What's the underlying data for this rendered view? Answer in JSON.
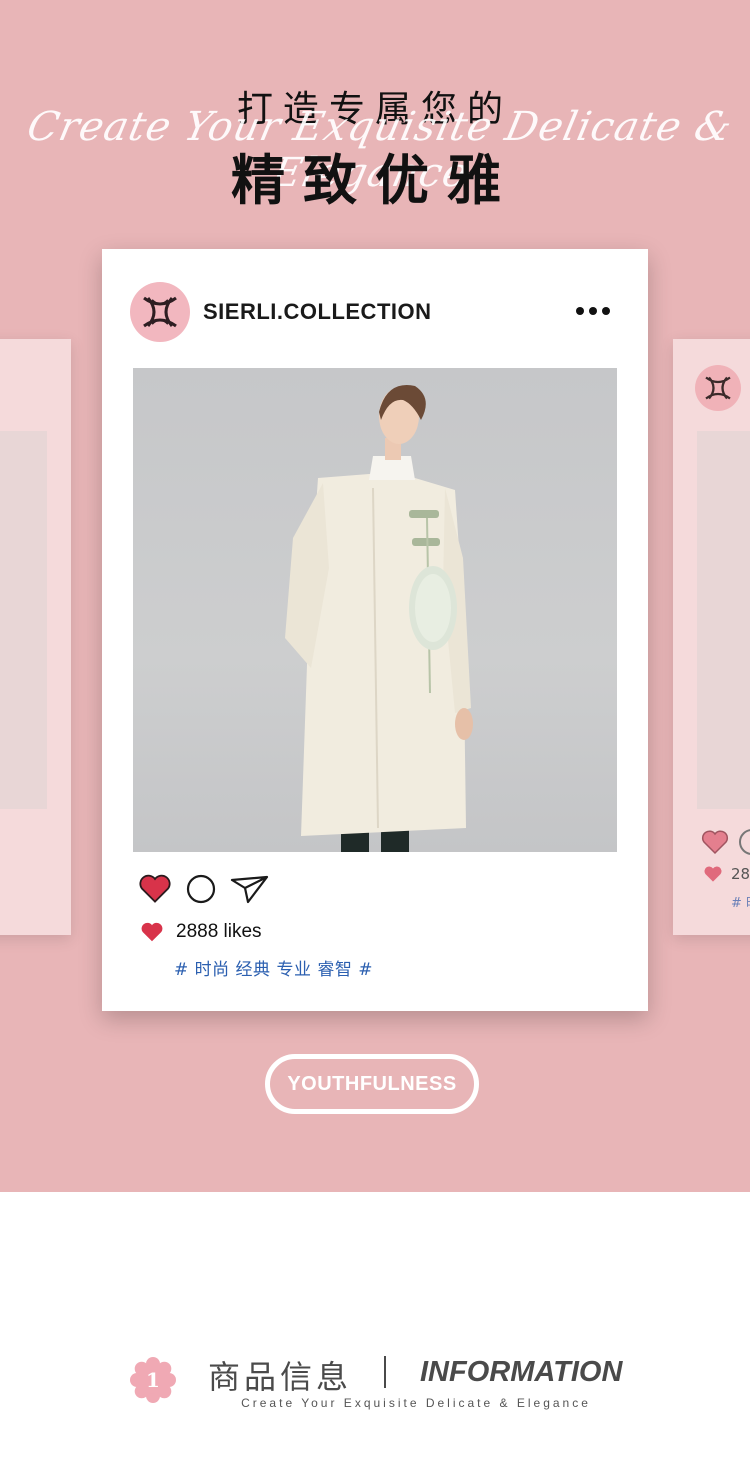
{
  "colors": {
    "hero_background": "#e8b5b7",
    "side_card": "#f5dadb",
    "heart_red": "#d8334a",
    "hashtag_blue": "#2b5fb0",
    "avatar_pink": "#f2b7bf"
  },
  "hero": {
    "headline_line1": "打造专属您的",
    "script_line": "Create Your Exquisite Delicate & Elegance",
    "headline_line2": "精致优雅"
  },
  "post": {
    "handle": "SIERLI.COLLECTION",
    "more_icon": "more-dots-icon",
    "likes_text": "2888 likes",
    "hashtags": "# 时尚 经典 专业 睿智 #",
    "action_icons": [
      "heart-icon",
      "comment-icon",
      "send-icon"
    ]
  },
  "side_post": {
    "likes_fragment": "28",
    "tag_fragment": "# 时"
  },
  "cta": {
    "label": "YOUTHFULNESS"
  },
  "section": {
    "number": "1",
    "title_cn": "商品信息",
    "title_en": "INFORMATION",
    "subtitle": "Create Your Exquisite Delicate & Elegance"
  }
}
